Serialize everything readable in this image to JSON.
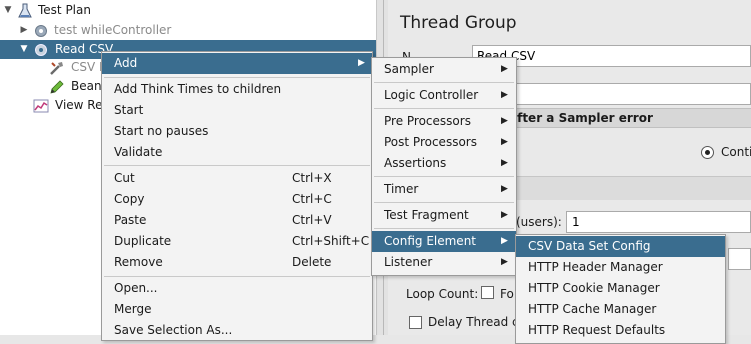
{
  "tree": {
    "test_plan": "Test Plan",
    "while_controller": "test whileController",
    "read_csv": "Read CSV",
    "csv_config": "CSV D",
    "bean": "Bean",
    "view_results": "View Re"
  },
  "panel": {
    "title": "Thread Group",
    "name_label": "N",
    "name_value": "Read CSV",
    "error_action_header": "after a Sampler error",
    "continue_label": "Conti",
    "users_label": "(users):",
    "users_value": "1",
    "loop_count_label": "Loop Count:",
    "forever_label": "Fo",
    "delay_label": "Delay Thread cr"
  },
  "context_menu": {
    "add": "Add",
    "add_think_times": "Add Think Times to children",
    "start": "Start",
    "start_no_pauses": "Start no pauses",
    "validate": "Validate",
    "cut": "Cut",
    "cut_shortcut": "Ctrl+X",
    "copy": "Copy",
    "copy_shortcut": "Ctrl+C",
    "paste": "Paste",
    "paste_shortcut": "Ctrl+V",
    "duplicate": "Duplicate",
    "duplicate_shortcut": "Ctrl+Shift+C",
    "remove": "Remove",
    "remove_shortcut": "Delete",
    "open": "Open...",
    "merge": "Merge",
    "save_selection": "Save Selection As..."
  },
  "add_menu": {
    "sampler": "Sampler",
    "logic_controller": "Logic Controller",
    "pre_processors": "Pre Processors",
    "post_processors": "Post Processors",
    "assertions": "Assertions",
    "timer": "Timer",
    "test_fragment": "Test Fragment",
    "config_element": "Config Element",
    "listener": "Listener"
  },
  "config_menu": {
    "csv_data_set_config": "CSV Data Set Config",
    "http_header_manager": "HTTP Header Manager",
    "http_cookie_manager": "HTTP Cookie Manager",
    "http_cache_manager": "HTTP Cache Manager",
    "http_request_defaults": "HTTP Request Defaults"
  },
  "colors": {
    "selection": "#3a6d8f",
    "menu_background": "#f3f3f3",
    "panel_background": "#e9e9e9"
  },
  "icons": [
    "expand-triangle-icon",
    "test-plan-flask-icon",
    "gear-icon",
    "config-tool-icon",
    "beanshell-pencil-icon",
    "results-graph-icon",
    "submenu-arrow-icon",
    "radio-selected-icon",
    "checkbox-icon"
  ]
}
